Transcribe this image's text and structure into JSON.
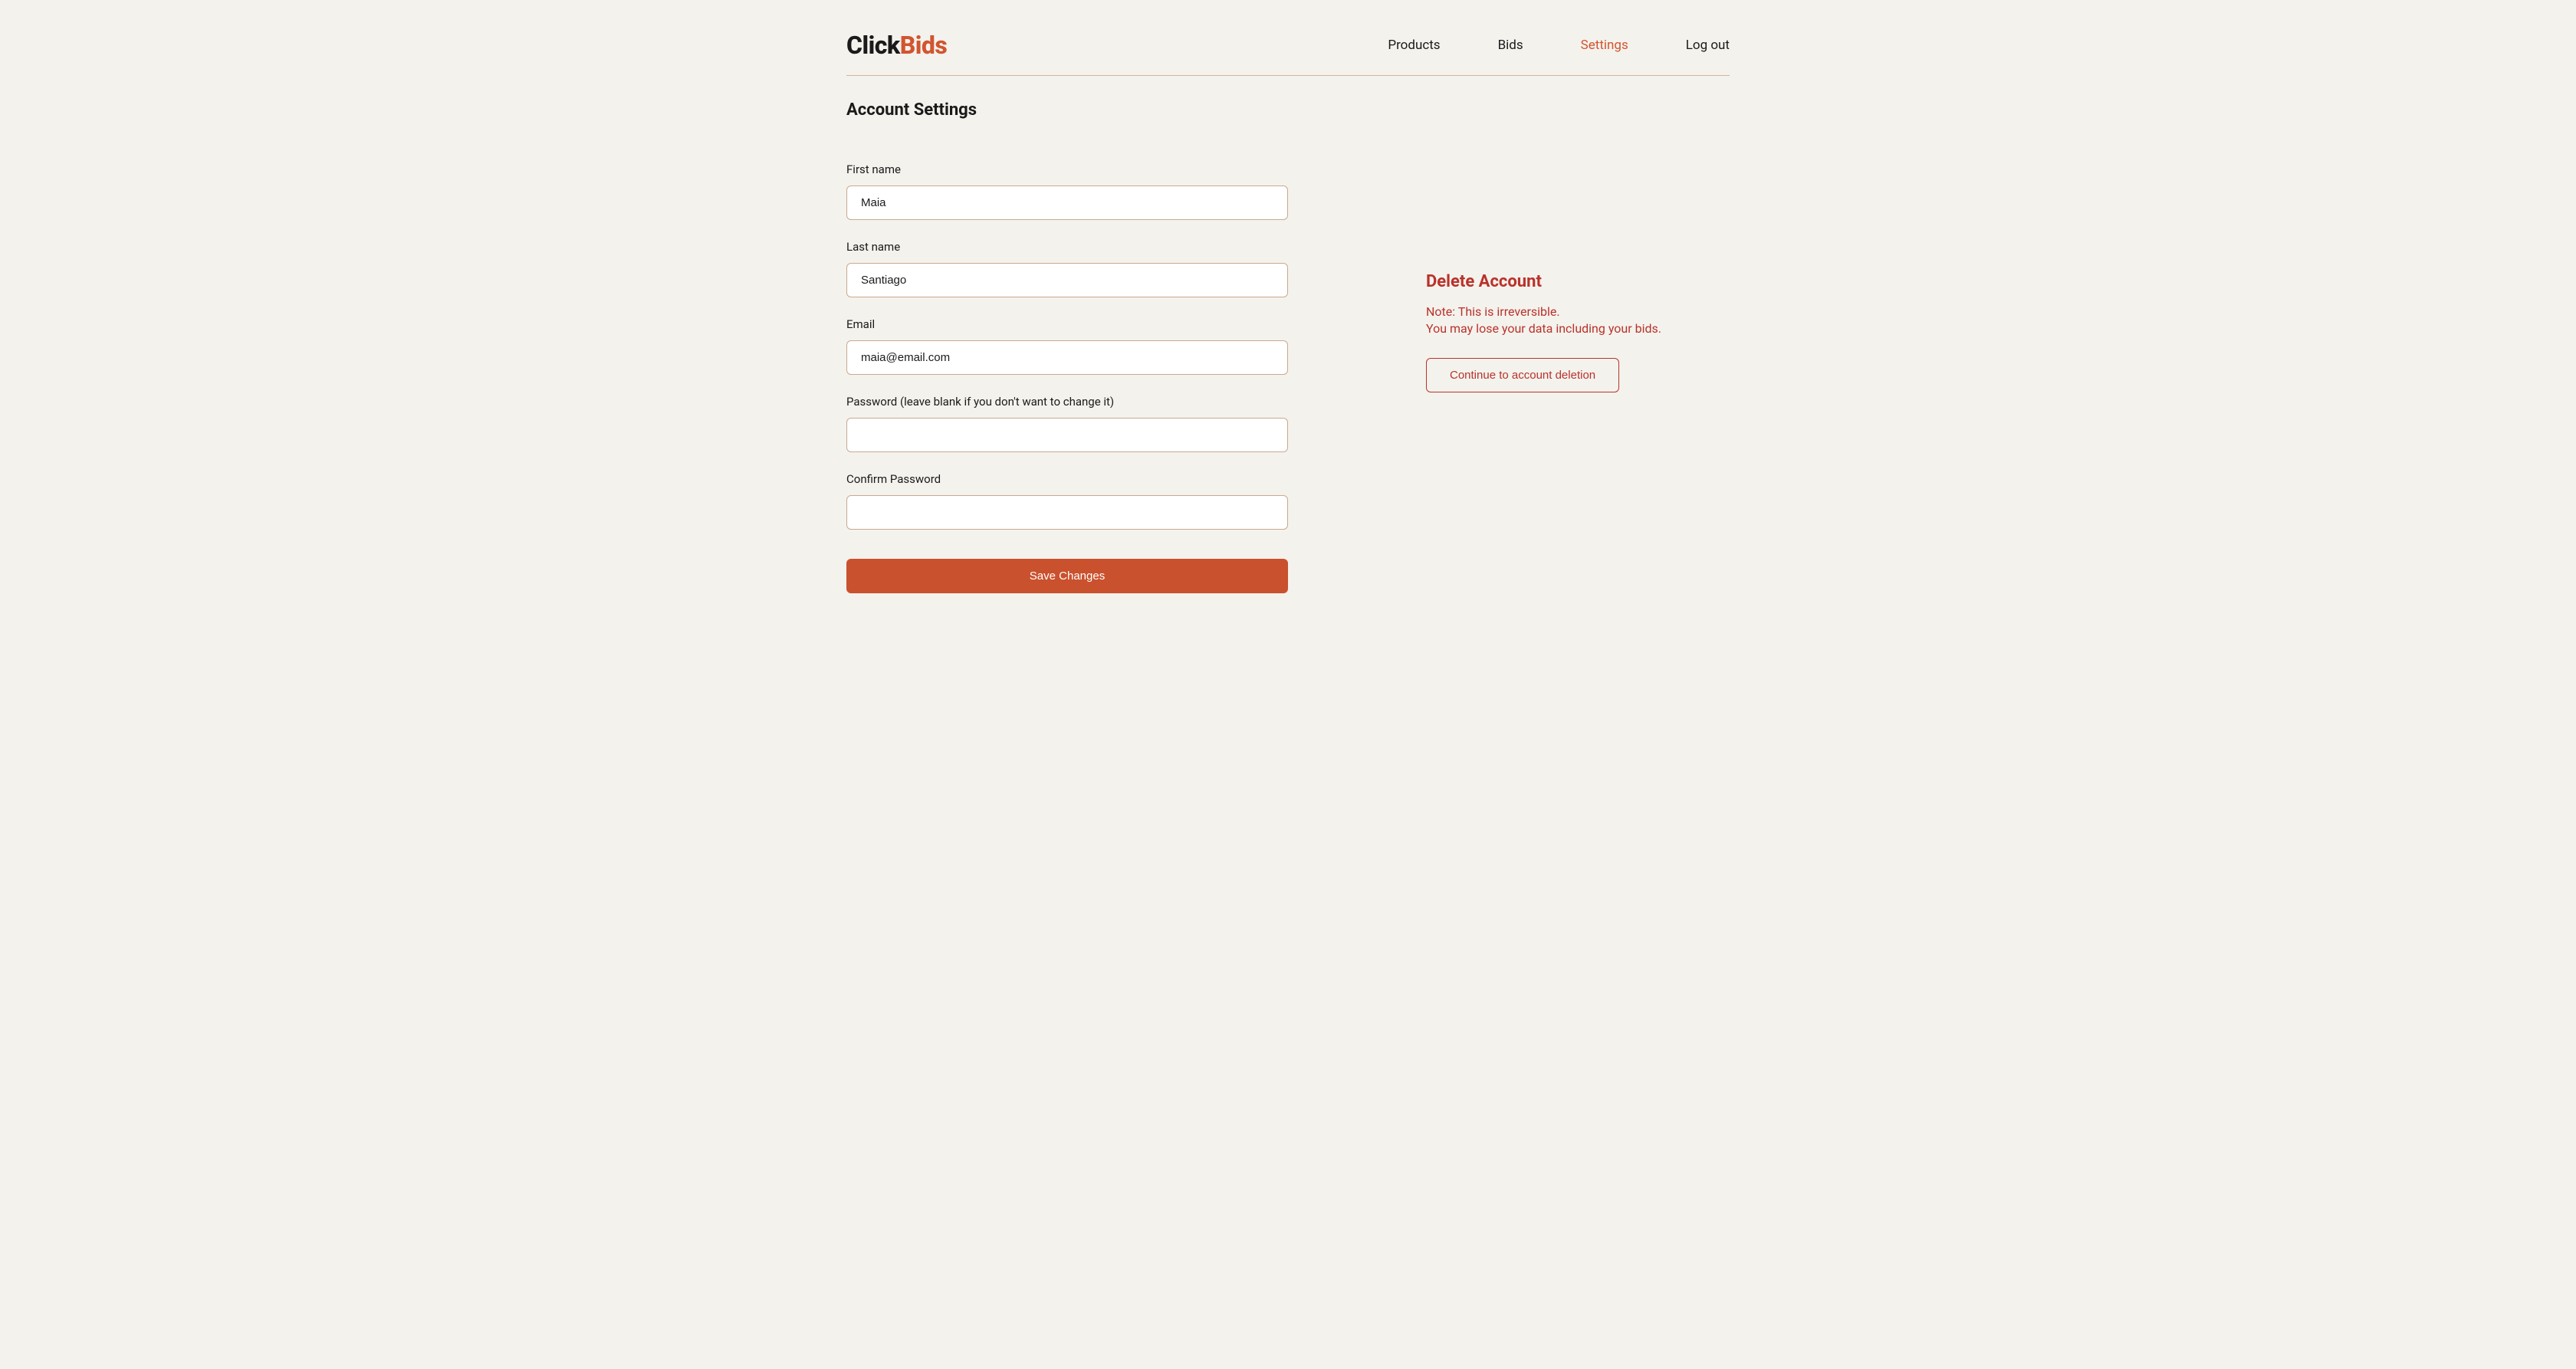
{
  "logo": {
    "part1": "Click",
    "part2": "B",
    "part3": "ids"
  },
  "nav": {
    "products": "Products",
    "bids": "Bids",
    "settings": "Settings",
    "logout": "Log out"
  },
  "page": {
    "title": "Account Settings"
  },
  "form": {
    "first_name": {
      "label": "First name",
      "value": "Maia"
    },
    "last_name": {
      "label": "Last name",
      "value": "Santiago"
    },
    "email": {
      "label": "Email",
      "value": "maia@email.com"
    },
    "password": {
      "label": "Password (leave blank if you don't want to change it)",
      "value": ""
    },
    "confirm_password": {
      "label": "Confirm Password",
      "value": ""
    },
    "save_button": "Save Changes"
  },
  "danger": {
    "title": "Delete Account",
    "note_line1": "Note: This is irreversible.",
    "note_line2": "You may lose your data including your bids.",
    "delete_button": "Continue to account deletion"
  }
}
